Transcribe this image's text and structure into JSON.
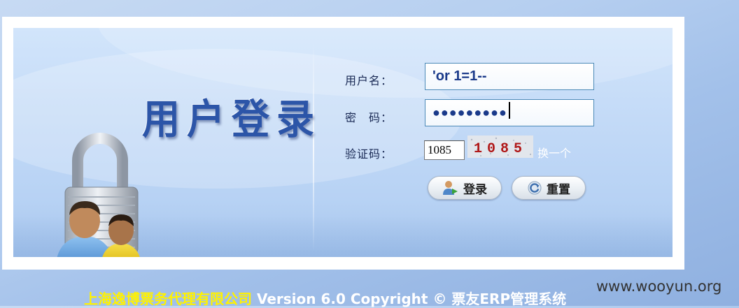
{
  "login": {
    "title": "用户登录",
    "username_label": "用户名：",
    "username_value": "'or 1=1--",
    "password_label": "密　码：",
    "password_masked": "●●●●●●●●●",
    "captcha_label": "验证码：",
    "captcha_input_value": "1085",
    "captcha_image_text": "1085",
    "refresh_captcha_link": "换一个",
    "login_button": "登录",
    "reset_button": "重置"
  },
  "footer": {
    "company": "上海逸博票务代理有限公司",
    "version_text": " Version 6.0 Copyright © 票友ERP管理系统"
  },
  "watermark": "www.wooyun.org",
  "colors": {
    "footer_company": "#fff200",
    "title_text": "#2c55a8",
    "field_border": "#4c8ab8",
    "input_text": "#1a3a8a",
    "captcha_digits": "#b01818"
  }
}
